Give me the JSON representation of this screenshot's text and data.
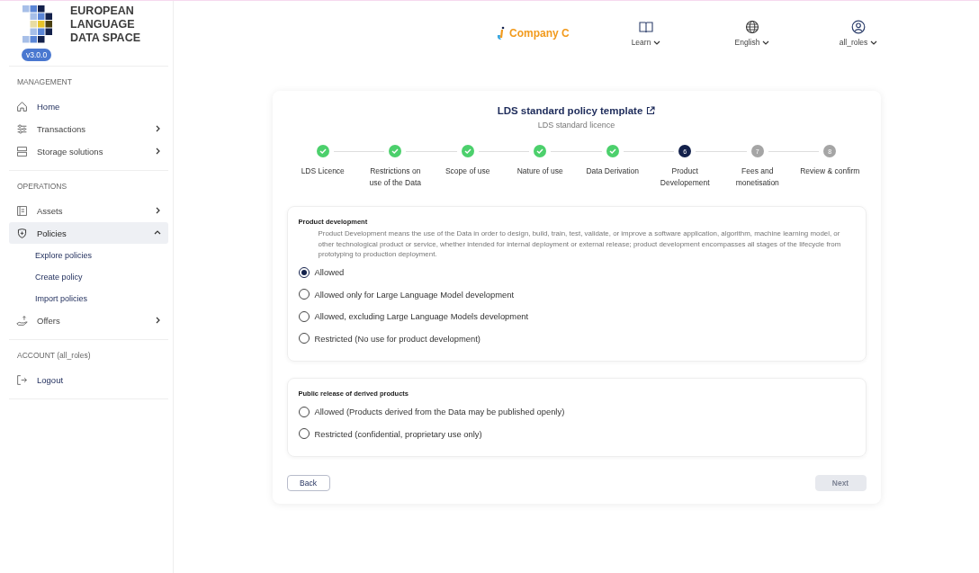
{
  "brand": {
    "title_lines": [
      "EUROPEAN",
      "LANGUAGE",
      "DATA SPACE"
    ],
    "version": "v3.0.0"
  },
  "sidebar": {
    "sections": [
      {
        "title": "MANAGEMENT",
        "items": [
          {
            "label": "Home",
            "kind": "link",
            "selected": false
          },
          {
            "label": "Transactions",
            "kind": "group",
            "selected": false,
            "expanded": false
          },
          {
            "label": "Storage solutions",
            "kind": "group",
            "selected": false,
            "expanded": false
          }
        ]
      },
      {
        "title": "OPERATIONS",
        "items": [
          {
            "label": "Assets",
            "kind": "group",
            "selected": false,
            "expanded": false
          },
          {
            "label": "Policies",
            "kind": "group",
            "selected": true,
            "expanded": true,
            "children": [
              {
                "label": "Explore policies"
              },
              {
                "label": "Create policy"
              },
              {
                "label": "Import policies"
              }
            ]
          },
          {
            "label": "Offers",
            "kind": "group",
            "selected": false,
            "expanded": false
          }
        ]
      },
      {
        "title": "ACCOUNT (all_roles)",
        "items": [
          {
            "label": "Logout",
            "kind": "link",
            "selected": false
          }
        ]
      }
    ]
  },
  "header": {
    "company": "Company C",
    "menus": [
      {
        "label": "Learn"
      },
      {
        "label": "English"
      },
      {
        "label": "all_roles"
      }
    ]
  },
  "wizard": {
    "title": "LDS standard policy template",
    "subtitle": "LDS standard licence",
    "steps": [
      {
        "label": "LDS Licence",
        "done": true
      },
      {
        "label": "Restrictions on use of the Data",
        "done": true
      },
      {
        "label": "Scope of use",
        "done": true
      },
      {
        "label": "Nature of use",
        "done": true
      },
      {
        "label": "Data Derivation",
        "done": true
      },
      {
        "number": "6",
        "label": "Product Developement",
        "done": false,
        "current": true
      },
      {
        "number": "7",
        "label": "Fees and monetisation",
        "done": false,
        "current": false
      },
      {
        "number": "8",
        "label": "Review & confirm",
        "done": false,
        "current": false
      }
    ],
    "questions": [
      {
        "title": "Product development",
        "description": "Product Development means the use of the Data in order to design, build, train, test, validate, or improve a software application, algorithm, machine learning model, or other technological product or service, whether intended for internal deployment or external release; product development encompasses all stages of the lifecycle from prototyping to production deployment.",
        "options": [
          {
            "label": "Allowed",
            "selected": true
          },
          {
            "label": "Allowed only for Large Language Model development",
            "selected": false
          },
          {
            "label": "Allowed, excluding Large Language Models development",
            "selected": false
          },
          {
            "label": "Restricted (No use for product development)",
            "selected": false
          }
        ]
      },
      {
        "title": "Public release of derived products",
        "options": [
          {
            "label": "Allowed (Products derived from the Data may be published openly)",
            "selected": false
          },
          {
            "label": "Restricted (confidential, proprietary use only)",
            "selected": false
          }
        ]
      }
    ],
    "back": {
      "label": "Back",
      "disabled": false
    },
    "next": {
      "label": "Next",
      "disabled": true
    }
  }
}
